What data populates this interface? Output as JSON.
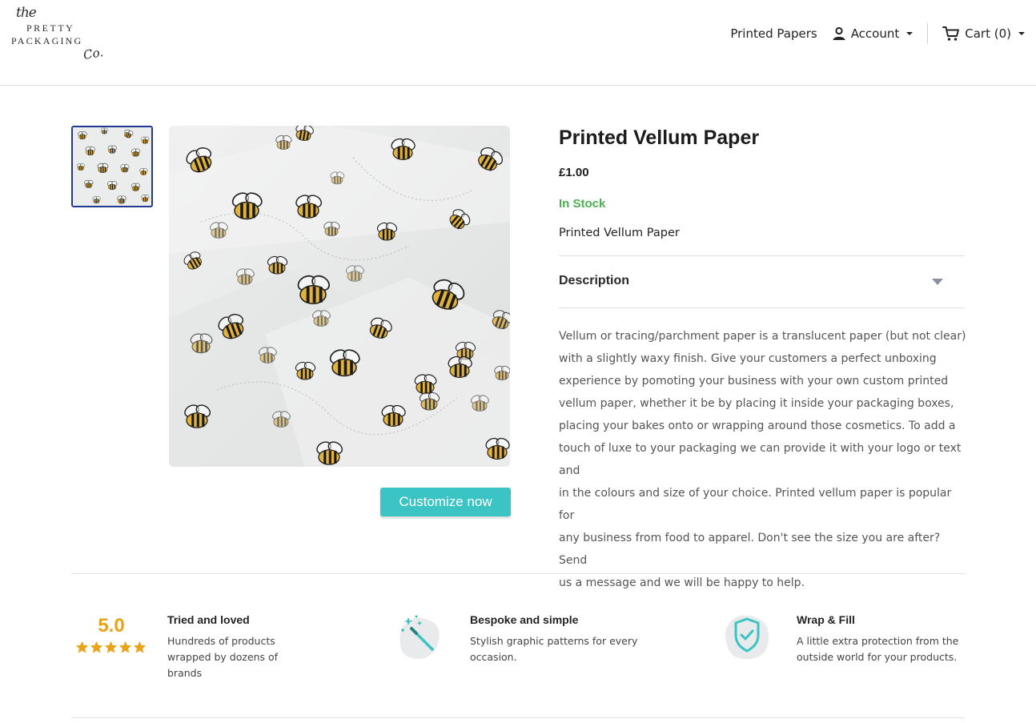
{
  "brand": {
    "logo_the": "the",
    "logo_line1": "PRETTY",
    "logo_line2": "PACKAGING",
    "logo_co": "Co."
  },
  "nav": {
    "printed_papers": "Printed Papers",
    "account": "Account",
    "cart": "Cart (0)"
  },
  "icons": {
    "account": "user-icon",
    "cart": "cart-icon",
    "description_toggle": "chevron-down-icon",
    "bespoke": "magic-wand-icon",
    "wrap": "shield-check-icon",
    "rating": "star-icon"
  },
  "colors": {
    "accent": "#3cc4c4",
    "in_stock": "#4caf50",
    "rating": "#e8a317",
    "thumb_border": "#1f3a93"
  },
  "product": {
    "title": "Printed Vellum Paper",
    "price": "£1.00",
    "stock": "In Stock",
    "short_description": "Printed Vellum Paper",
    "description_label": "Description",
    "description_lines": [
      "Vellum or tracing/parchment paper is a translucent paper (but not clear)",
      "with a slightly waxy finish. Give your customers a perfect unboxing",
      "experience by pomoting your business with your own custom printed",
      "vellum paper, whether it be by placing it inside your packaging boxes,",
      "placing your bakes onto or wrapping around those cosmetics. To add a",
      "touch of luxe to your packaging we can provide it with your logo or text and",
      "in the colours and size of your choice. Printed vellum paper is popular for",
      "any business from food to apparel. Don't see the size you are after? Send",
      "us a message and we will be happy to help."
    ],
    "customize_label": "Customize now"
  },
  "features": {
    "rating_value": "5.0",
    "rating_stars": 5,
    "tried": {
      "title": "Tried and loved",
      "lines": [
        "Hundreds of products",
        "wrapped by dozens of",
        "brands"
      ]
    },
    "bespoke": {
      "title": "Bespoke and simple",
      "lines": [
        "Stylish graphic patterns for every",
        "occasion."
      ]
    },
    "wrap": {
      "title": "Wrap & Fill",
      "lines": [
        "A little extra protection from the",
        "outside world for your products."
      ]
    }
  }
}
